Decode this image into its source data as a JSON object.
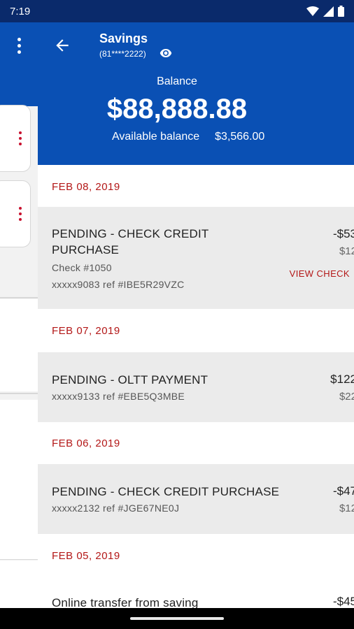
{
  "status_bar": {
    "time": "7:19"
  },
  "header": {
    "title": "Savings",
    "account_number": "(81****2222)",
    "balance_label": "Balance",
    "balance": "$88,888.88",
    "available_label": "Available balance",
    "available_value": "$3,566.00"
  },
  "groups": [
    {
      "date": "FEB 08, 2019",
      "transactions": [
        {
          "title_line1": "PENDING - CHECK CREDIT",
          "title_line2": "PURCHASE",
          "sub1": "Check #1050",
          "sub2": "xxxxx9083 ref #IBE5R29VZC",
          "amount": "-$53",
          "amount2": "$12",
          "action": "VIEW CHECK"
        }
      ]
    },
    {
      "date": "FEB 07, 2019",
      "transactions": [
        {
          "title_line1": "PENDING - OLTT PAYMENT",
          "sub1": "xxxxx9133 ref #EBE5Q3MBE",
          "amount": "$122",
          "amount2": "$22"
        }
      ]
    },
    {
      "date": "FEB 06, 2019",
      "transactions": [
        {
          "title_line1": "PENDING - CHECK CREDIT PURCHASE",
          "sub1": "xxxxx2132 ref #JGE67NE0J",
          "amount": "-$47",
          "amount2": "$12"
        }
      ]
    },
    {
      "date": "FEB 05, 2019",
      "transactions": [
        {
          "title_line1": "Online transfer from saving",
          "amount": "-$45"
        }
      ]
    }
  ],
  "icons": {
    "back": "arrow-left-icon",
    "eye": "eye-icon",
    "menu": "more-vert-icon",
    "wifi": "wifi-icon",
    "signal": "signal-icon",
    "battery": "battery-icon"
  },
  "colors": {
    "header_blue": "#0a50b4",
    "status_blue": "#0a2a6b",
    "date_red": "#b31717",
    "row_gray": "#ebebeb"
  }
}
